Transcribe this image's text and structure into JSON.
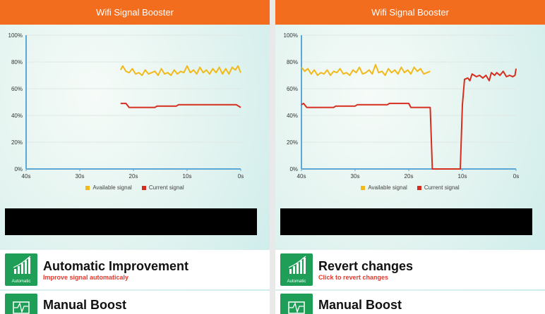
{
  "app_title": "Wifi Signal Booster",
  "colors": {
    "titlebar": "#f26d1e",
    "available": "#f2b91b",
    "current": "#d62e1e",
    "icon_bg": "#1f9e57"
  },
  "legend": {
    "available": "Available signal",
    "current": "Current signal"
  },
  "panels": [
    {
      "chart_data": {
        "type": "line",
        "x_ticks": [
          "40s",
          "30s",
          "20s",
          "10s",
          "0s"
        ],
        "y_ticks": [
          "0%",
          "20%",
          "40%",
          "60%",
          "80%",
          "100%"
        ],
        "xlim": [
          40,
          0
        ],
        "ylim": [
          0,
          100
        ],
        "series": [
          {
            "name": "Available signal",
            "color": "available",
            "points": [
              [
                22.4,
                74
              ],
              [
                22,
                77
              ],
              [
                21.4,
                73
              ],
              [
                20.8,
                72
              ],
              [
                20.2,
                75
              ],
              [
                19.6,
                71
              ],
              [
                19,
                72
              ],
              [
                18.4,
                70
              ],
              [
                17.8,
                74
              ],
              [
                17.2,
                71
              ],
              [
                16.6,
                72
              ],
              [
                16,
                73
              ],
              [
                15.4,
                70
              ],
              [
                14.8,
                75
              ],
              [
                14.2,
                71
              ],
              [
                13.6,
                72
              ],
              [
                13,
                70
              ],
              [
                12.4,
                74
              ],
              [
                11.8,
                71
              ],
              [
                11.2,
                73
              ],
              [
                10.6,
                72
              ],
              [
                10,
                77
              ],
              [
                9.4,
                72
              ],
              [
                8.8,
                74
              ],
              [
                8.2,
                71
              ],
              [
                7.6,
                76
              ],
              [
                7,
                72
              ],
              [
                6.4,
                74
              ],
              [
                5.8,
                71
              ],
              [
                5.2,
                75
              ],
              [
                4.6,
                72
              ],
              [
                4,
                76
              ],
              [
                3.4,
                71
              ],
              [
                2.8,
                75
              ],
              [
                2.2,
                71
              ],
              [
                1.6,
                76
              ],
              [
                1,
                74
              ],
              [
                0.5,
                77
              ],
              [
                0,
                72
              ]
            ]
          },
          {
            "name": "Current signal",
            "color": "current",
            "points": [
              [
                22.4,
                49
              ],
              [
                21.4,
                49
              ],
              [
                20.8,
                46
              ],
              [
                16,
                46
              ],
              [
                15.6,
                47
              ],
              [
                12,
                47
              ],
              [
                11.6,
                48
              ],
              [
                0.8,
                48
              ],
              [
                0,
                46
              ]
            ]
          }
        ]
      },
      "card1": {
        "icon": "signal-bars-icon",
        "icon_label": "Automatic",
        "title": "Automatic Improvement",
        "subtitle": "Improve signal automaticaly"
      },
      "card2": {
        "icon": "pulse-icon",
        "title": "Manual Boost"
      }
    },
    {
      "chart_data": {
        "type": "line",
        "x_ticks": [
          "40s",
          "30s",
          "20s",
          "10s",
          "0s"
        ],
        "y_ticks": [
          "0%",
          "20%",
          "40%",
          "60%",
          "80%",
          "100%"
        ],
        "xlim": [
          40,
          0
        ],
        "ylim": [
          0,
          100
        ],
        "series": [
          {
            "name": "Available signal",
            "color": "available",
            "points": [
              [
                40,
                76
              ],
              [
                39.4,
                73
              ],
              [
                38.8,
                75
              ],
              [
                38.2,
                71
              ],
              [
                37.6,
                74
              ],
              [
                37,
                70
              ],
              [
                36.4,
                72
              ],
              [
                35.8,
                71
              ],
              [
                35.2,
                74
              ],
              [
                34.6,
                70
              ],
              [
                34,
                73
              ],
              [
                33.4,
                72
              ],
              [
                32.8,
                75
              ],
              [
                32.2,
                71
              ],
              [
                31.6,
                72
              ],
              [
                31,
                70
              ],
              [
                30.4,
                74
              ],
              [
                29.8,
                72
              ],
              [
                29.2,
                76
              ],
              [
                28.6,
                71
              ],
              [
                28,
                72
              ],
              [
                27.4,
                74
              ],
              [
                26.8,
                71
              ],
              [
                26.2,
                78
              ],
              [
                25.6,
                72
              ],
              [
                25,
                73
              ],
              [
                24.4,
                70
              ],
              [
                23.8,
                75
              ],
              [
                23.2,
                72
              ],
              [
                22.6,
                74
              ],
              [
                22,
                71
              ],
              [
                21.4,
                76
              ],
              [
                20.8,
                72
              ],
              [
                20.2,
                74
              ],
              [
                19.6,
                71
              ],
              [
                19,
                76
              ],
              [
                18.4,
                73
              ],
              [
                17.8,
                75
              ],
              [
                17.2,
                71
              ],
              [
                16.6,
                72
              ],
              [
                16,
                73
              ]
            ]
          },
          {
            "name": "Current signal",
            "color": "current",
            "points": [
              [
                40,
                48
              ],
              [
                39.6,
                49
              ],
              [
                39,
                46
              ],
              [
                34,
                46
              ],
              [
                33.6,
                47
              ],
              [
                30,
                47
              ],
              [
                29.6,
                48
              ],
              [
                24,
                48
              ],
              [
                23.6,
                49
              ],
              [
                20,
                49
              ],
              [
                19.6,
                46
              ],
              [
                16,
                46
              ],
              [
                15.6,
                0
              ],
              [
                10.4,
                0
              ],
              [
                10,
                48
              ],
              [
                9.6,
                67
              ],
              [
                9,
                68
              ],
              [
                8.6,
                66
              ],
              [
                8.2,
                71
              ],
              [
                7.4,
                69
              ],
              [
                6.8,
                70
              ],
              [
                6.2,
                68
              ],
              [
                5.6,
                70
              ],
              [
                5,
                66
              ],
              [
                4.6,
                72
              ],
              [
                4,
                70
              ],
              [
                3.6,
                72
              ],
              [
                3,
                70
              ],
              [
                2.4,
                73
              ],
              [
                1.8,
                69
              ],
              [
                1.2,
                70
              ],
              [
                0.6,
                69
              ],
              [
                0.2,
                70
              ],
              [
                0,
                75
              ]
            ]
          }
        ]
      },
      "card1": {
        "icon": "signal-bars-icon",
        "icon_label": "Automatic",
        "title": "Revert changes",
        "subtitle": "Click to revert changes"
      },
      "card2": {
        "icon": "pulse-icon",
        "title": "Manual Boost"
      }
    }
  ]
}
